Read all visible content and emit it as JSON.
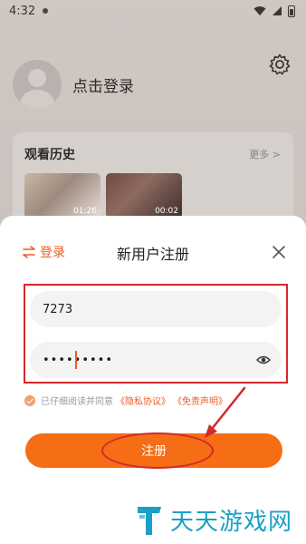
{
  "status_bar": {
    "time": "4:32"
  },
  "profile": {
    "login_prompt": "点击登录"
  },
  "history": {
    "title": "观看历史",
    "more": "更多 >",
    "items": [
      {
        "duration": "01:26"
      },
      {
        "duration": "00:02"
      }
    ]
  },
  "sheet": {
    "switch_label": "登录",
    "title": "新用户注册",
    "username_value": "7273",
    "password_value": "•••••••••",
    "agreement": {
      "prefix": "已仔细阅读并同意",
      "privacy": "《隐私协议》",
      "disclaimer": "《免责声明》"
    },
    "register_label": "注册"
  },
  "watermark": {
    "text": "天天游戏网"
  },
  "colors": {
    "accent": "#f56d14",
    "annotation": "#d4282b"
  }
}
